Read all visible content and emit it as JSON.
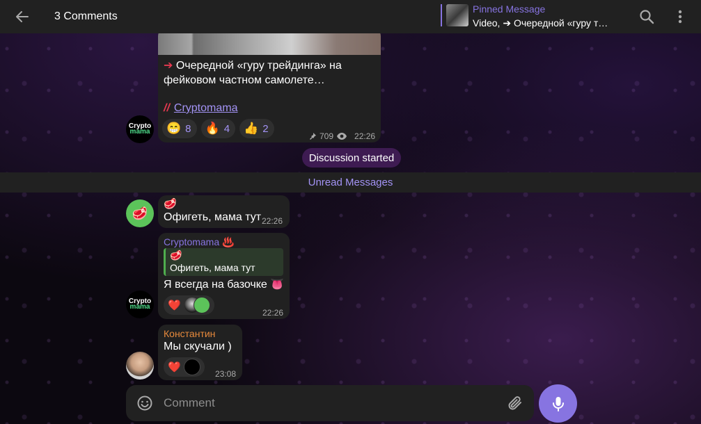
{
  "header": {
    "title": "3 Comments",
    "pinned": {
      "title": "Pinned Message",
      "text": "Video, ➔ Очередной «гуру т…"
    }
  },
  "post": {
    "text": "Очередной «гуру трейдинга» на фейковом частном самолете…",
    "signature": "Cryptomama",
    "reactions": [
      {
        "emoji": "😁",
        "count": "8"
      },
      {
        "emoji": "🔥",
        "count": "4"
      },
      {
        "emoji": "👍",
        "count": "2"
      }
    ],
    "views": "709",
    "time": "22:26"
  },
  "avatar_text": {
    "line1": "Crypto",
    "line2": "mama"
  },
  "service": {
    "discussion_started": "Discussion started",
    "unread": "Unread Messages"
  },
  "messages": [
    {
      "emoji": "🥩",
      "text": "Офигеть, мама тут",
      "time": "22:26"
    },
    {
      "sender": "Cryptomama ♨️",
      "reply_emoji": "🥩",
      "reply_text": "Офигеть, мама тут",
      "text": "Я всегда на базочке 👅",
      "reaction": "❤️",
      "time": "22:26"
    },
    {
      "sender": "Константин",
      "text": "Мы скучали )",
      "reaction": "❤️",
      "time": "23:08"
    }
  ],
  "composer": {
    "placeholder": "Comment"
  },
  "colors": {
    "accent": "#8774e1",
    "sender_cryptomama": "#8774e1",
    "sender_konstantin": "#e88a3c",
    "bubble": "#212121"
  }
}
